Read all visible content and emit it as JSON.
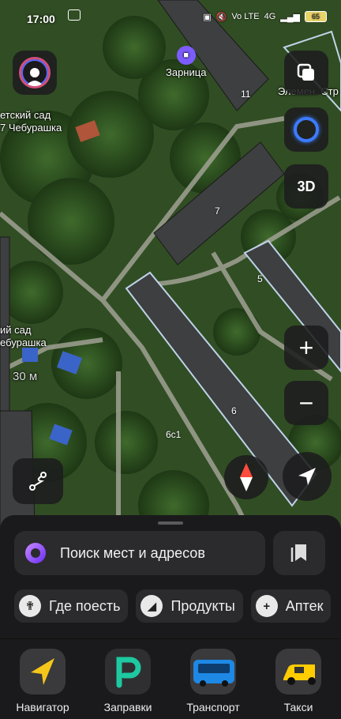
{
  "status_bar": {
    "time": "17:00",
    "network": "Vo LTE",
    "signal": "4G",
    "battery": "65"
  },
  "map": {
    "poi_zarnitsa": "Зарница",
    "poi_kindergarten_1": "етский сад\n7 Чебурашка",
    "poi_kindergarten_2": "ий сад\nебурашка",
    "poi_street": "Элемен. Стр",
    "scale": "30 м",
    "buildings": [
      "11",
      "7",
      "5",
      "6",
      "6с1"
    ]
  },
  "controls": {
    "mode_3d": "3D",
    "zoom_in": "+",
    "zoom_out": "−"
  },
  "search": {
    "placeholder": "Поиск мест и адресов"
  },
  "chips": [
    {
      "label": "Где поесть",
      "icon": "fork-knife-icon"
    },
    {
      "label": "Продукты",
      "icon": "basket-icon"
    },
    {
      "label": "Аптек",
      "icon": "plus-icon"
    }
  ],
  "apps": [
    {
      "label": "Навигатор",
      "icon": "navigator-arrow-icon"
    },
    {
      "label": "Заправки",
      "icon": "fuel-p-icon"
    },
    {
      "label": "Транспорт",
      "icon": "bus-icon"
    },
    {
      "label": "Такси",
      "icon": "taxi-car-icon"
    }
  ],
  "colors": {
    "accent_alice": "#7b3cff",
    "navigator_yellow": "#f5c71a",
    "fuel_green": "#1ec8a0",
    "transport_blue": "#1e88e5",
    "taxi_yellow": "#ffcc00"
  }
}
